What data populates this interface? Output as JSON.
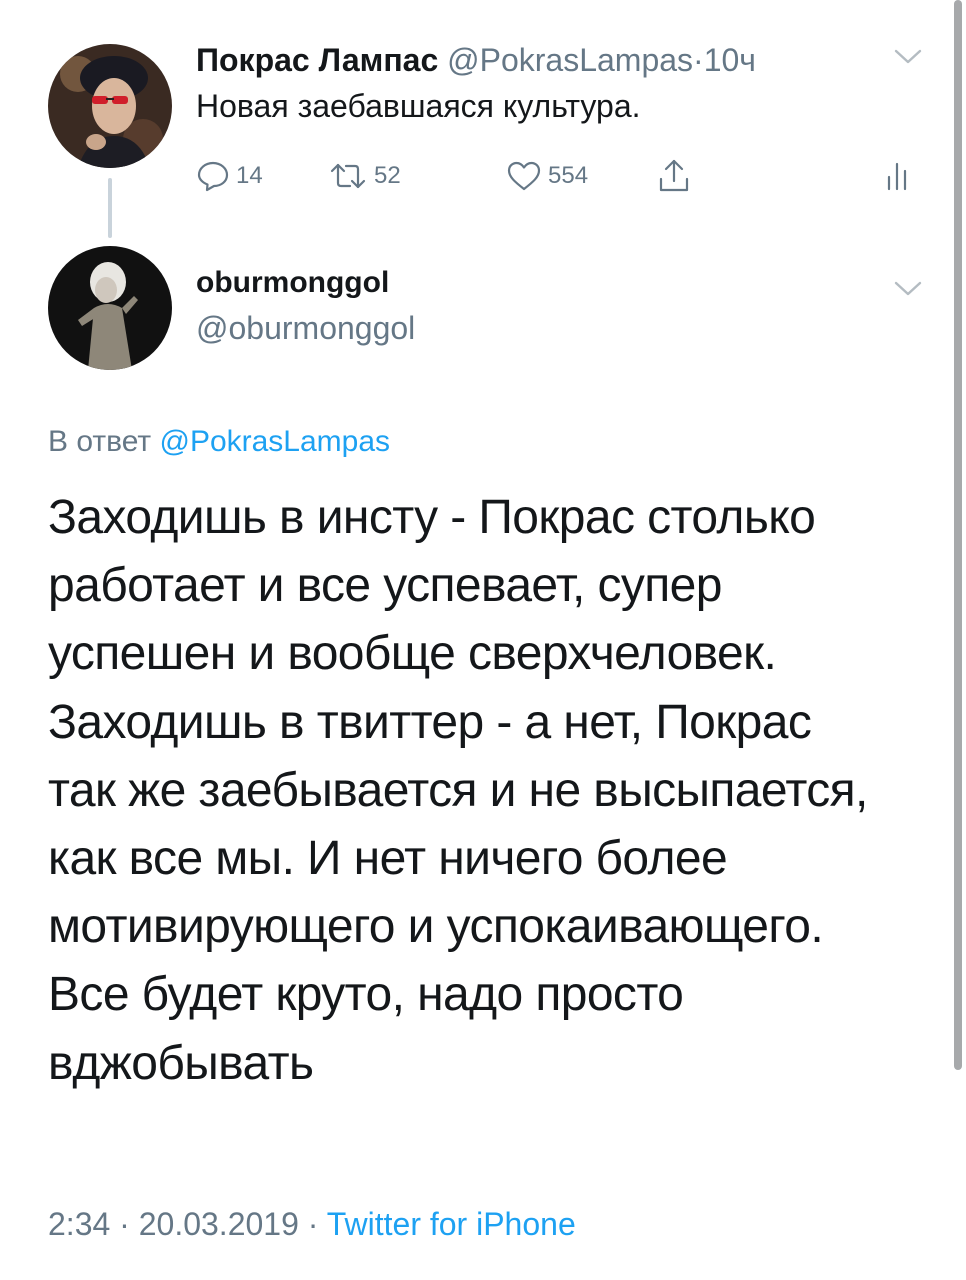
{
  "parent_tweet": {
    "display_name": "Покрас Лампас",
    "handle": "@PokrasLampas",
    "separator": "·",
    "time": "10ч",
    "text": "Новая заебавшаяся культура.",
    "actions": {
      "reply_count": "14",
      "retweet_count": "52",
      "like_count": "554"
    }
  },
  "reply_tweet": {
    "display_name": "oburmonggol",
    "handle": "@oburmonggol",
    "reply_to_prefix": "В ответ",
    "reply_to_handle": "@PokrasLampas",
    "text_lines": [
      "Заходишь в инсту - Покрас столько",
      "работает и все успевает, супер",
      "успешен и вообще сверхчеловек.",
      "Заходишь в твиттер - а нет, Покрас",
      "так же заебывается и не высыпается,",
      "как все мы. И нет ничего более",
      "мотивирующего и успокаивающего.",
      "Все будет круто, надо просто",
      "вджобывать"
    ],
    "timestamp": "2:34 · 20.03.2019 ·",
    "source": "Twitter for iPhone"
  },
  "colors": {
    "text_primary": "#14171a",
    "text_secondary": "#657786",
    "link_blue": "#1da1f2",
    "thread_line": "#c9d3db"
  },
  "icons": {
    "reply": "speech-bubble-icon",
    "retweet": "retweet-arrows-icon",
    "like": "heart-icon",
    "share": "share-upload-icon",
    "stats": "analytics-bars-icon",
    "caret": "chevron-down-icon"
  }
}
